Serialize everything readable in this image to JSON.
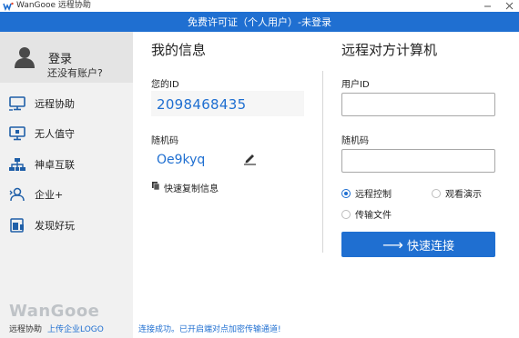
{
  "window": {
    "title": "WanGooe 远程协助",
    "logo_icon": "wangooe-logo-icon",
    "controls": [
      "minimize-icon",
      "close-icon"
    ]
  },
  "banner": {
    "text": "免费许可证（个人用户）-未登录"
  },
  "sidebar": {
    "login": {
      "title": "登录",
      "subtitle": "还没有账户?"
    },
    "items": [
      {
        "label": "远程协助",
        "icon": "monitor-icon"
      },
      {
        "label": "无人值守",
        "icon": "unattended-monitor-icon"
      },
      {
        "label": "神卓互联",
        "icon": "network-icon"
      },
      {
        "label": "企业+",
        "icon": "enterprise-user-icon"
      },
      {
        "label": "发现好玩",
        "icon": "discover-icon"
      }
    ],
    "brand": "WanGooe",
    "footer_text": "远程协助",
    "footer_link": "上传企业LOGO"
  },
  "my_info": {
    "title": "我的信息",
    "id_label": "您的ID",
    "id_value": "2098468435",
    "password_label": "随机码",
    "password_value": "Oe9kyq",
    "copy_label": "快速复制信息"
  },
  "remote": {
    "title": "远程对方计算机",
    "user_id_label": "用户ID",
    "user_id_value": "",
    "password_label": "随机码",
    "password_value": "",
    "options": [
      {
        "label": "远程控制",
        "selected": true
      },
      {
        "label": "观看演示",
        "selected": false
      },
      {
        "label": "传输文件",
        "selected": false
      }
    ],
    "connect_arrow": "⟶",
    "connect_label": "快速连接"
  },
  "status": "连接成功。已开启端对点加密传输通道!",
  "colors": {
    "accent": "#1f6fd1",
    "sidebar_bg": "#f1f1f1",
    "login_bg": "#e4e4e4"
  }
}
